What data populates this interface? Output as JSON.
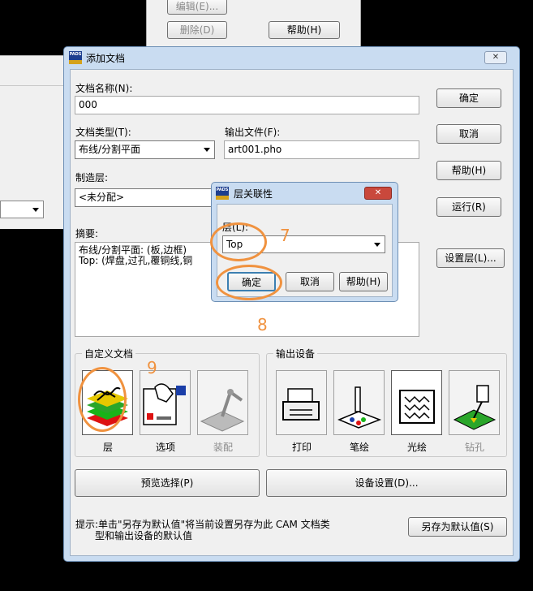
{
  "background_window": {
    "edit_button": "编辑(E)...",
    "delete_button": "删除(D)",
    "help_button": "帮助(H)"
  },
  "main_dialog": {
    "title": "添加文档",
    "app_badge": "PADS",
    "doc_name_label": "文档名称(N):",
    "doc_name_value": "000",
    "doc_type_label": "文档类型(T):",
    "doc_type_value": "布线/分割平面",
    "output_file_label": "输出文件(F):",
    "output_file_value": "art001.pho",
    "fab_layer_label": "制造层:",
    "fab_layer_value": "<未分配>",
    "summary_label": "摘要:",
    "summary_lines": [
      "布线/分割平面: (板,边框)",
      "Top: (焊盘,过孔,覆铜线,铜"
    ],
    "buttons": {
      "ok": "确定",
      "cancel": "取消",
      "help": "帮助(H)",
      "run": "运行(R)",
      "set_layers": "设置层(L)..."
    },
    "custom_doc": {
      "title": "自定义文档",
      "items": [
        "层",
        "选项",
        "装配"
      ]
    },
    "output_device": {
      "title": "输出设备",
      "items": [
        "打印",
        "笔绘",
        "光绘",
        "钻孔"
      ]
    },
    "preview_button": "预览选择(P)",
    "device_setup_button": "设备设置(D)...",
    "hint_text_line1": "提示:单击\"另存为默认值\"将当前设置另存为此 CAM 文档类",
    "hint_text_line2": "型和输出设备的默认值",
    "save_default_button": "另存为默认值(S)"
  },
  "layer_dialog": {
    "title": "层关联性",
    "app_badge": "PADS",
    "layer_label": "层(L):",
    "layer_value": "Top",
    "ok": "确定",
    "cancel": "取消",
    "help": "帮助(H)"
  },
  "annotations": [
    "7",
    "8",
    "9"
  ],
  "colors": {
    "annotation": "#f0923f",
    "dialog_bg": "#f0f0f0",
    "titlebar": "#c9dcf1"
  }
}
